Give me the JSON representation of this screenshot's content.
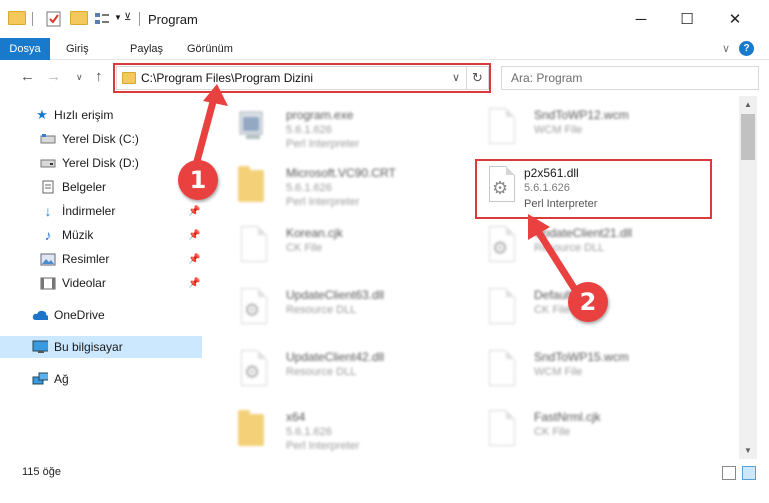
{
  "window": {
    "title": "Program",
    "minimize": "─",
    "maximize": "☐",
    "close": "✕"
  },
  "ribbon": {
    "tabs": [
      "Dosya",
      "Giriş",
      "Paylaş",
      "Görünüm"
    ],
    "collapse": "∨",
    "help": "?"
  },
  "address": {
    "path": "C:\\Program Files\\Program Dizini",
    "refresh": "↻",
    "dropdown": "∨"
  },
  "search": {
    "placeholder": "Ara: Program"
  },
  "sidebar": {
    "items": [
      {
        "label": "Hızlı erişim",
        "icon": "star-icon"
      },
      {
        "label": "Yerel Disk (C:)",
        "icon": "drive-icon"
      },
      {
        "label": "Yerel Disk (D:)",
        "icon": "drive-icon"
      },
      {
        "label": "Belgeler",
        "icon": "document-icon"
      },
      {
        "label": "İndirmeler",
        "icon": "download-icon"
      },
      {
        "label": "Müzik",
        "icon": "music-icon"
      },
      {
        "label": "Resimler",
        "icon": "picture-icon"
      },
      {
        "label": "Videolar",
        "icon": "video-icon"
      },
      {
        "label": "OneDrive",
        "icon": "cloud-icon"
      },
      {
        "label": "Bu bilgisayar",
        "icon": "computer-icon"
      },
      {
        "label": "Ağ",
        "icon": "network-icon"
      }
    ]
  },
  "files": [
    {
      "name": "program.exe",
      "line2": "5.6.1.626",
      "line3": "Perl Interpreter",
      "icon": "exe-icon"
    },
    {
      "name": "SndToWP12.wcm",
      "line2": "WCM File",
      "line3": "",
      "icon": "file-icon"
    },
    {
      "name": "Microsoft.VC90.CRT",
      "line2": "5.6.1.626",
      "line3": "Perl Interpreter",
      "icon": "folder-icon"
    },
    {
      "name": "p2x561.dll",
      "line2": "5.6.1.626",
      "line3": "Perl Interpreter",
      "icon": "dll-gear-icon"
    },
    {
      "name": "Korean.cjk",
      "line2": "CK File",
      "line3": "",
      "icon": "file-icon"
    },
    {
      "name": "UpdateClient21.dll",
      "line2": "Resource DLL",
      "line3": "",
      "icon": "dll-gear-icon"
    },
    {
      "name": "UpdateClient63.dll",
      "line2": "Resource DLL",
      "line3": "",
      "icon": "dll-gear-icon"
    },
    {
      "name": "Default.cjk",
      "line2": "CK File",
      "line3": "",
      "icon": "file-icon"
    },
    {
      "name": "UpdateClient42.dll",
      "line2": "Resource DLL",
      "line3": "",
      "icon": "dll-gear-icon"
    },
    {
      "name": "SndToWP15.wcm",
      "line2": "WCM File",
      "line3": "",
      "icon": "file-icon"
    },
    {
      "name": "x64",
      "line2": "5.6.1.626",
      "line3": "Perl Interpreter",
      "icon": "folder-icon"
    },
    {
      "name": "FastNrml.cjk",
      "line2": "CK File",
      "line3": "",
      "icon": "file-icon"
    }
  ],
  "status": {
    "count": "115 öğe"
  },
  "callouts": [
    "1",
    "2"
  ],
  "colors": {
    "accent": "#1979ca",
    "highlight": "#d93a3a",
    "badge": "#e94040"
  }
}
